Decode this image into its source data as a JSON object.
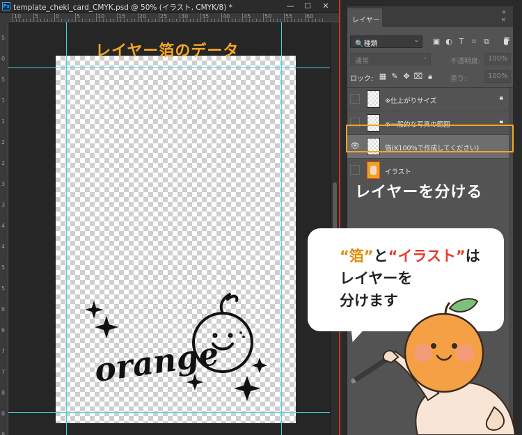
{
  "window": {
    "title": "template_cheki_card_CMYK.psd @ 50% (イラスト, CMYK/8) *",
    "minimize": "—",
    "maximize": "☐",
    "close": "✕"
  },
  "ruler": {
    "h_ticks": [
      "10",
      "5",
      "0",
      "5",
      "10",
      "15",
      "20",
      "25",
      "30",
      "35",
      "40",
      "45",
      "50",
      "55",
      "60"
    ],
    "v_ticks": [
      "5",
      "0",
      "5",
      "1",
      "1",
      "2",
      "2",
      "3",
      "3",
      "4",
      "4",
      "5",
      "5",
      "6",
      "6",
      "7",
      "7",
      "8",
      "8",
      "9"
    ]
  },
  "canvas": {
    "caption": "レイヤー箔のデータ",
    "artwork_word": "orange"
  },
  "layers_panel": {
    "tab": "レイヤー",
    "collapse": "«",
    "close": "×",
    "menu": "≡",
    "filter_label": "🔍種類",
    "blend_mode": "通常",
    "opacity_label": "不透明度:",
    "opacity_value": "100%",
    "lock_label": "ロック:",
    "fill_label": "塗り:",
    "fill_value": "100%",
    "layers": [
      {
        "name": "※仕上がりサイズ",
        "visible": false,
        "locked": true
      },
      {
        "name": "※一般的な写真の範囲",
        "visible": false,
        "locked": true
      },
      {
        "name": "箔(K100%で作成してください)",
        "visible": true,
        "locked": false
      },
      {
        "name": "イラスト",
        "visible": false,
        "locked": false
      }
    ]
  },
  "annotations": {
    "layers_caption": "レイヤーを分ける",
    "bubble_line1_q1": "“箔”",
    "bubble_line1_to": "と",
    "bubble_line1_q2": "“イラスト”",
    "bubble_line1_ha": "は",
    "bubble_line2": "レイヤーを",
    "bubble_line3": "分けます"
  },
  "colors": {
    "accent_orange": "#f5a623",
    "guide_cyan": "#3dd7e0",
    "highlight_red": "#e83a2a"
  }
}
